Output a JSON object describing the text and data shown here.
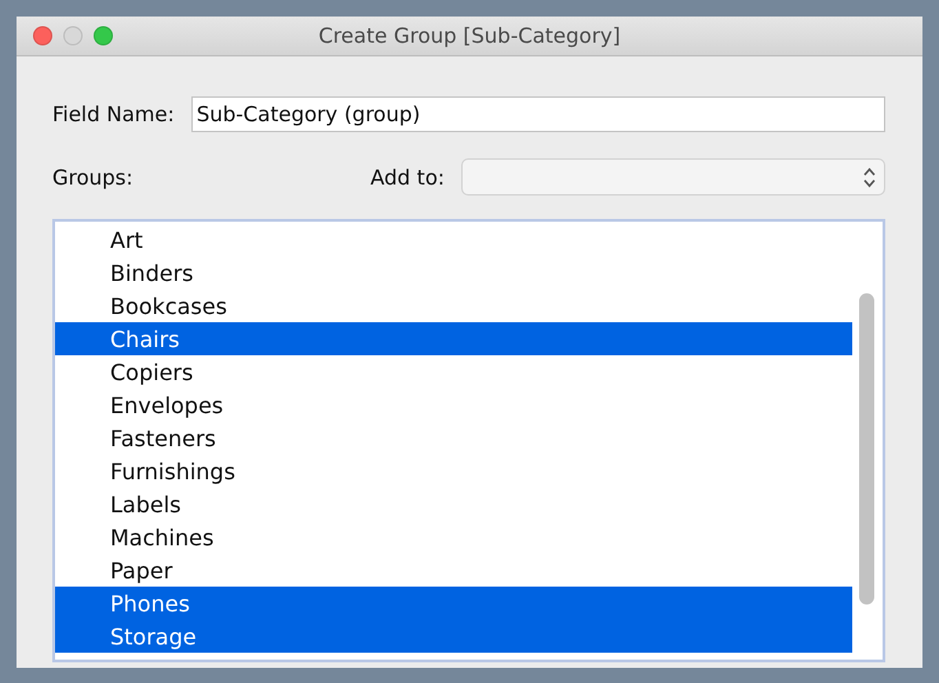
{
  "window": {
    "title": "Create Group [Sub-Category]"
  },
  "field_name": {
    "label": "Field Name:",
    "value": "Sub-Category (group)"
  },
  "groups_label": "Groups:",
  "add_to": {
    "label": "Add to:"
  },
  "groups": [
    {
      "label": "Art",
      "selected": false
    },
    {
      "label": "Binders",
      "selected": false
    },
    {
      "label": "Bookcases",
      "selected": false
    },
    {
      "label": "Chairs",
      "selected": true
    },
    {
      "label": "Copiers",
      "selected": false
    },
    {
      "label": "Envelopes",
      "selected": false
    },
    {
      "label": "Fasteners",
      "selected": false
    },
    {
      "label": "Furnishings",
      "selected": false
    },
    {
      "label": "Labels",
      "selected": false
    },
    {
      "label": "Machines",
      "selected": false
    },
    {
      "label": "Paper",
      "selected": false
    },
    {
      "label": "Phones",
      "selected": true
    },
    {
      "label": "Storage",
      "selected": true
    }
  ]
}
